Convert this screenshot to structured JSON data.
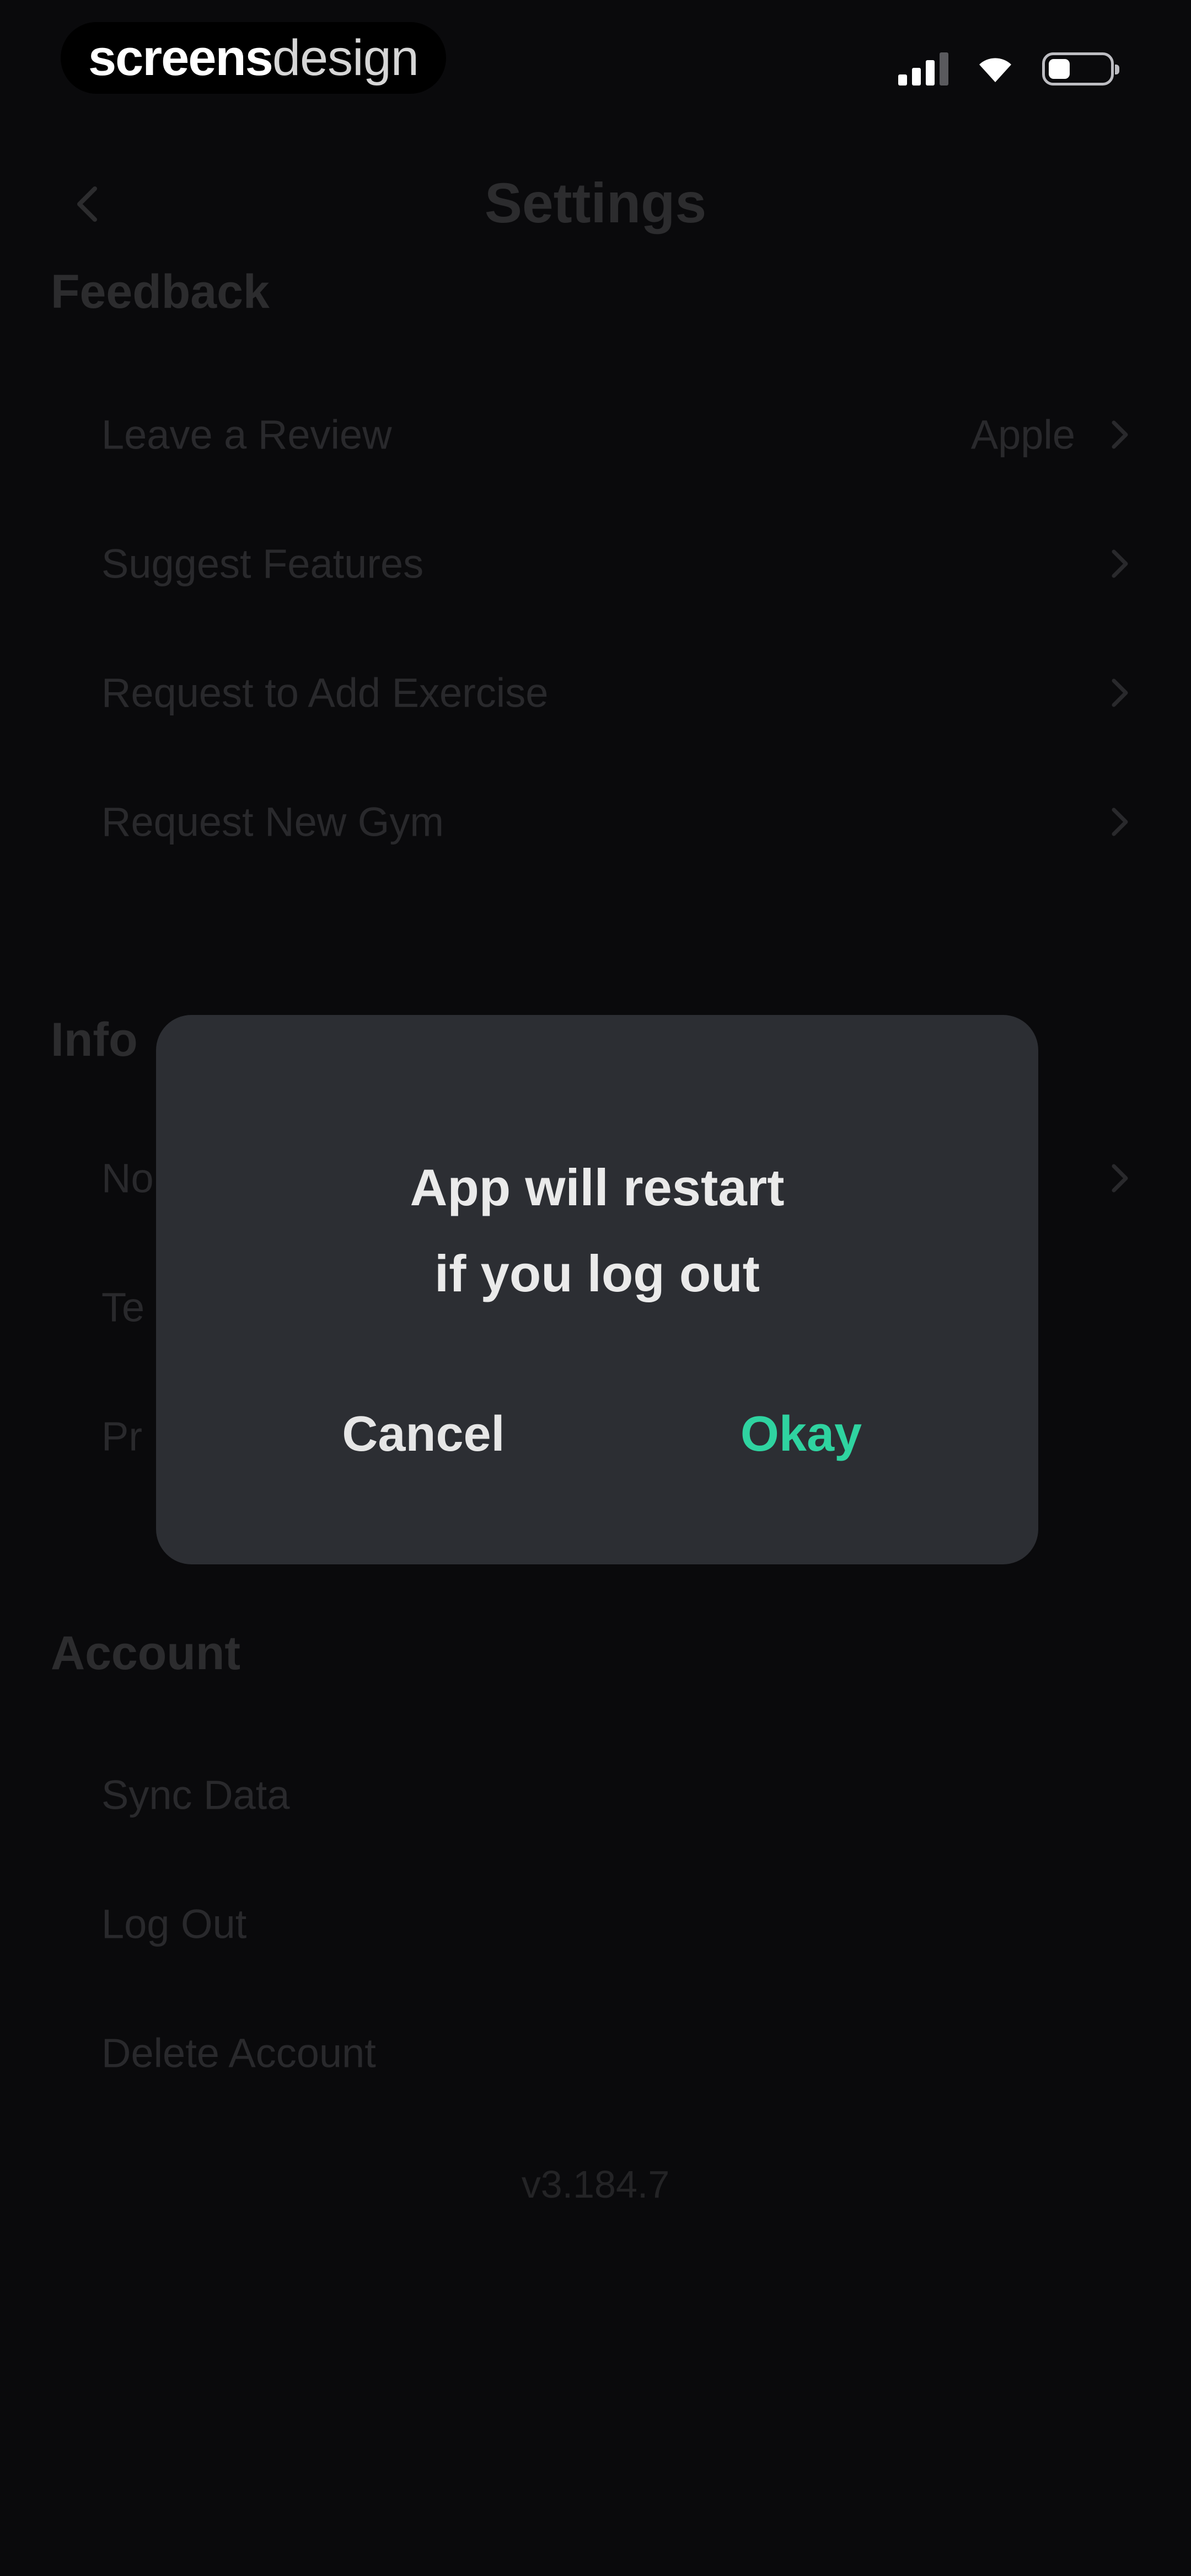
{
  "status_bar": {
    "brand_part1": "screens",
    "brand_part2": "design"
  },
  "nav": {
    "title": "Settings"
  },
  "feedback": {
    "title": "Feedback",
    "items": [
      {
        "label": "Leave a Review",
        "value": "Apple"
      },
      {
        "label": "Suggest Features"
      },
      {
        "label": "Request to Add Exercise"
      },
      {
        "label": "Request New Gym"
      }
    ]
  },
  "info": {
    "title": "Info",
    "items": [
      {
        "label": "No"
      },
      {
        "label": "Te"
      },
      {
        "label": "Pr"
      }
    ]
  },
  "account": {
    "title": "Account",
    "items": [
      {
        "label": "Sync Data"
      },
      {
        "label": "Log Out"
      },
      {
        "label": "Delete Account"
      }
    ]
  },
  "version": "v3.184.7",
  "dialog": {
    "message_line1": "App will restart",
    "message_line2": "if you log out",
    "cancel_label": "Cancel",
    "okay_label": "Okay"
  },
  "colors": {
    "background": "#0e0e10",
    "dialog": "#2c2e33",
    "accent": "#2fd3a0"
  }
}
